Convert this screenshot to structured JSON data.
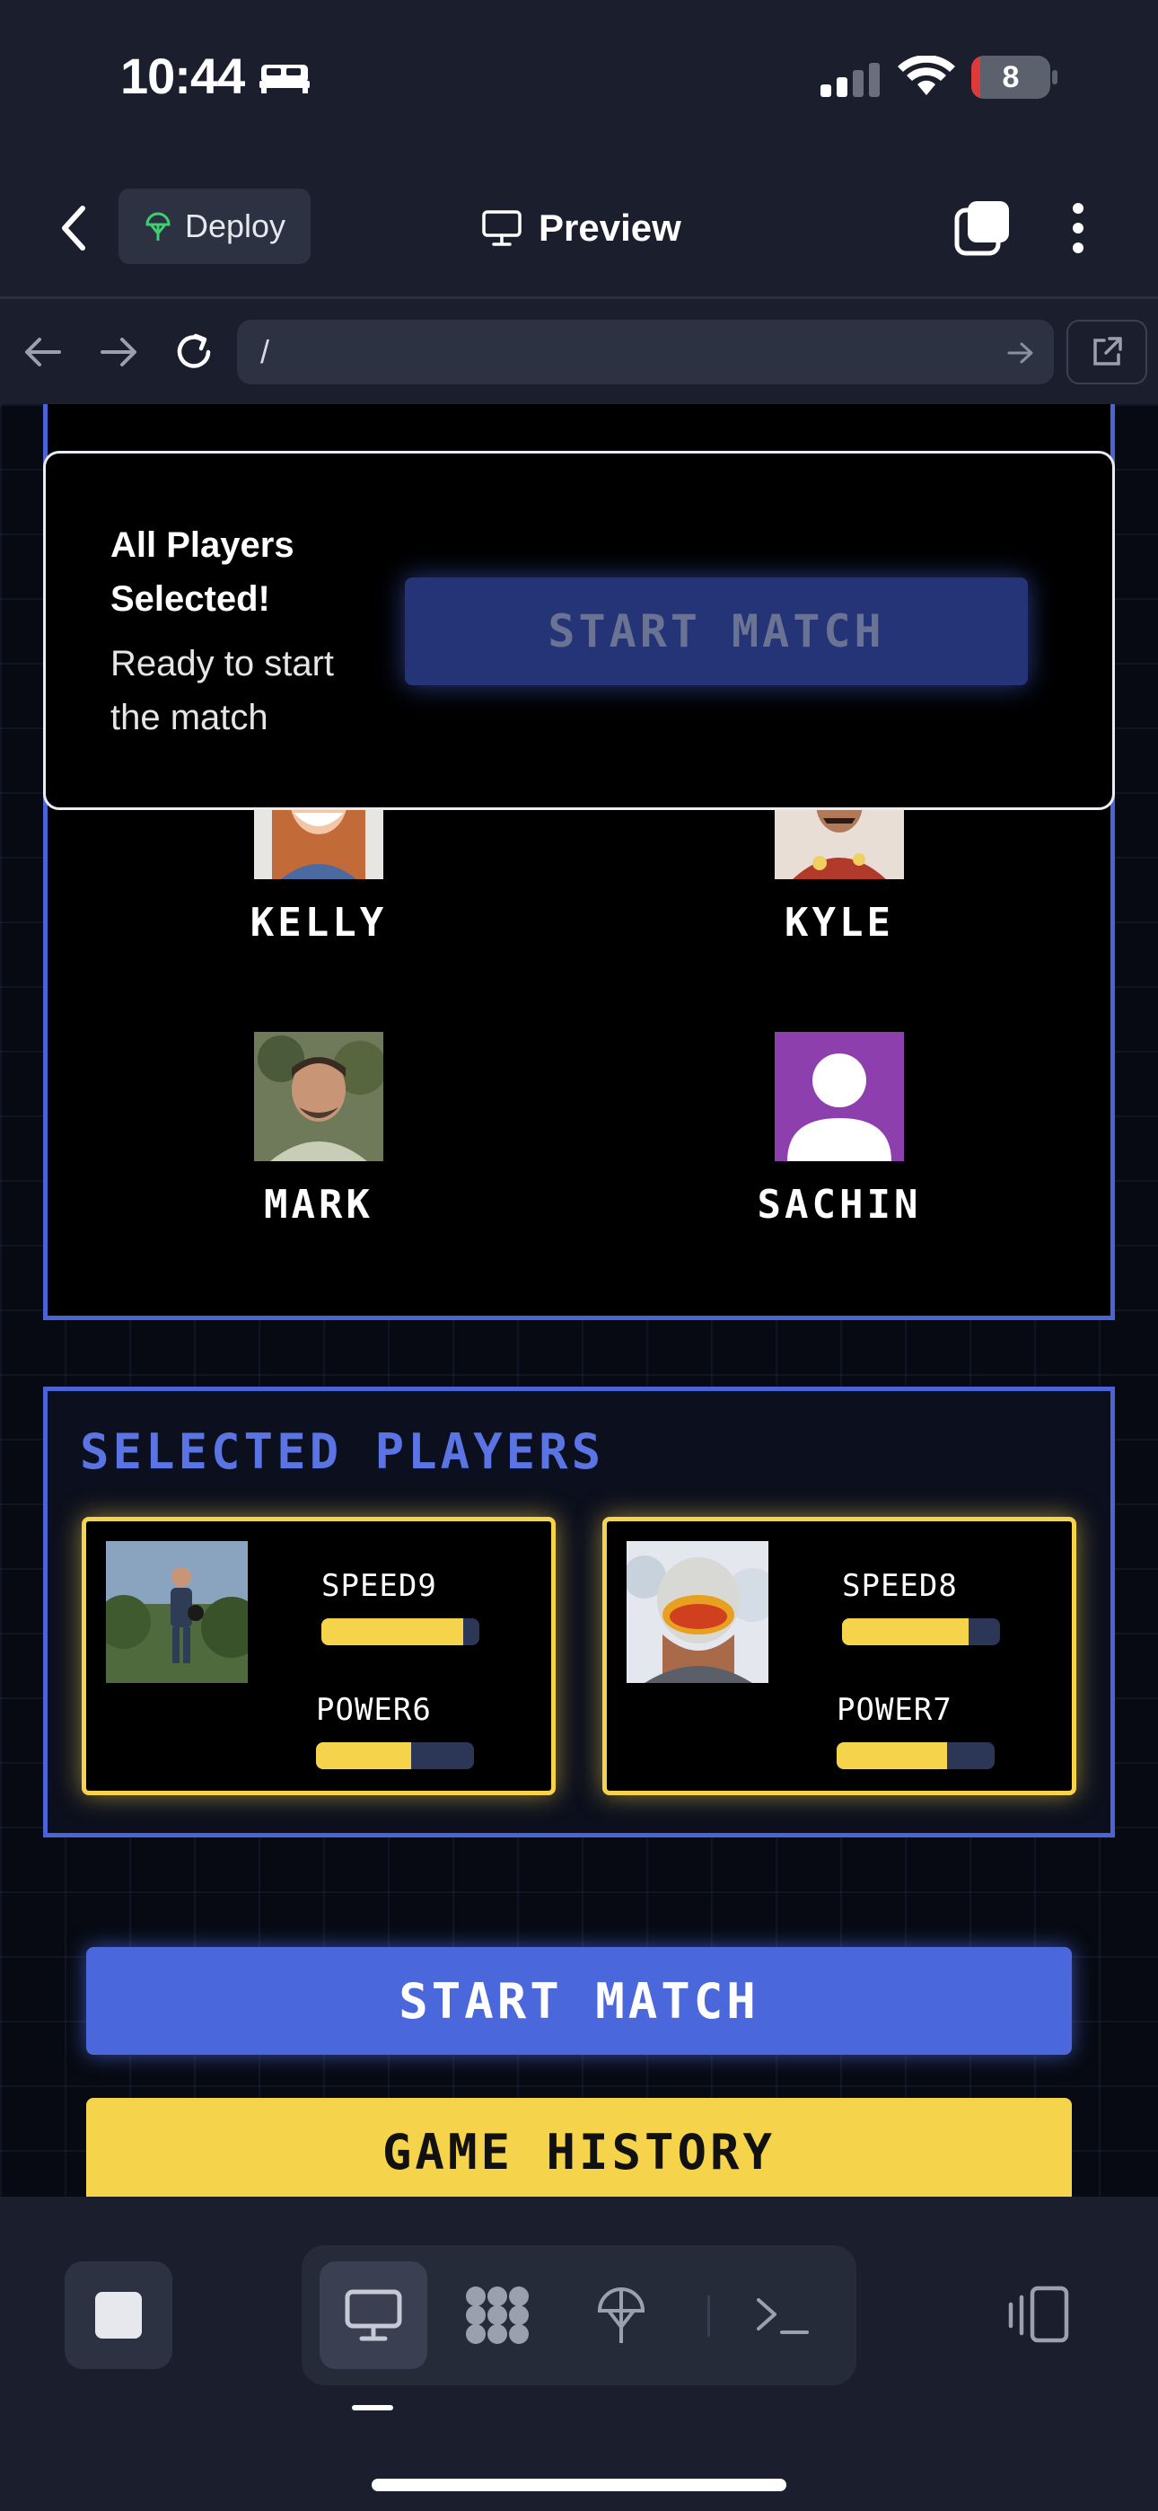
{
  "status_bar": {
    "time": "10:44",
    "battery": "8"
  },
  "app_bar": {
    "deploy_label": "Deploy",
    "title": "Preview"
  },
  "browser": {
    "url": "/"
  },
  "overlay": {
    "title": "All Players Selected!",
    "subtitle": "Ready to start the match",
    "button_label": "START MATCH"
  },
  "roster": {
    "players": [
      {
        "name": "KELLY",
        "avatar": "photo"
      },
      {
        "name": "KYLE",
        "avatar": "photo"
      },
      {
        "name": "MARK",
        "avatar": "photo"
      },
      {
        "name": "SACHIN",
        "avatar": "default-user-icon"
      }
    ]
  },
  "selected": {
    "title": "SELECTED PLAYERS",
    "cards": [
      {
        "speed_label": "SPEED9",
        "speed": 0.9,
        "power_label": "POWER6",
        "power": 0.6
      },
      {
        "speed_label": "SPEED8",
        "speed": 0.8,
        "power_label": "POWER7",
        "power": 0.7
      }
    ]
  },
  "actions": {
    "start_label": "START MATCH",
    "history_label": "GAME HISTORY"
  },
  "colors": {
    "accent_blue": "#4b67dc",
    "accent_yellow": "#f5d44c",
    "background": "#1b1f2d",
    "sachin_avatar_bg": "#8e3fae"
  }
}
